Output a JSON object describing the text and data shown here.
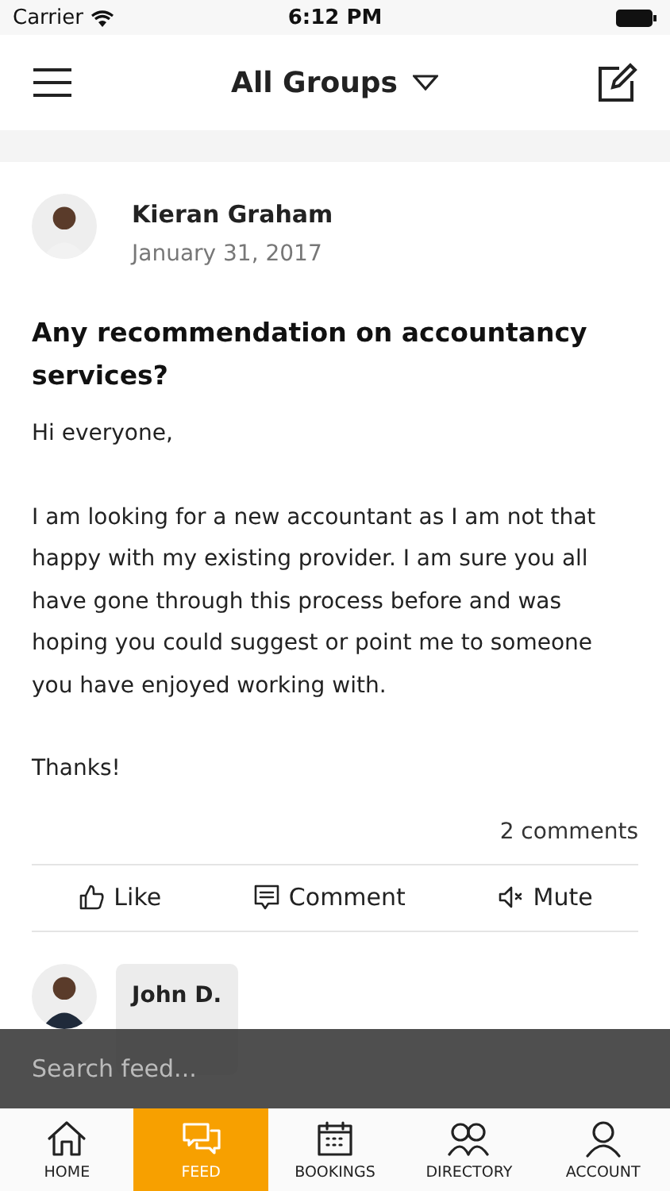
{
  "status_bar": {
    "carrier": "Carrier",
    "time": "6:12 PM"
  },
  "header": {
    "title": "All Groups"
  },
  "post": {
    "author": "Kieran Graham",
    "date": "January 31, 2017",
    "title": "Any recommendation on accountancy services?",
    "paragraphs": [
      "Hi everyone,",
      "I am looking for a new accountant as I am not that happy with my existing provider. I am sure you all have gone through this process before and was hoping you could suggest or point me to someone you have enjoyed working with.",
      "Thanks!"
    ],
    "comment_count": "2 comments",
    "actions": [
      {
        "kind": "like",
        "label": "Like"
      },
      {
        "kind": "comment",
        "label": "Comment"
      },
      {
        "kind": "mute",
        "label": "Mute"
      }
    ]
  },
  "comment": {
    "author": "John D."
  },
  "search": {
    "placeholder": "Search feed..."
  },
  "tabs": [
    {
      "kind": "home",
      "label": "HOME",
      "selected": false
    },
    {
      "kind": "feed",
      "label": "FEED",
      "selected": true
    },
    {
      "kind": "bookings",
      "label": "BOOKINGS",
      "selected": false
    },
    {
      "kind": "directory",
      "label": "DIRECTORY",
      "selected": false
    },
    {
      "kind": "account",
      "label": "ACCOUNT",
      "selected": false
    }
  ]
}
